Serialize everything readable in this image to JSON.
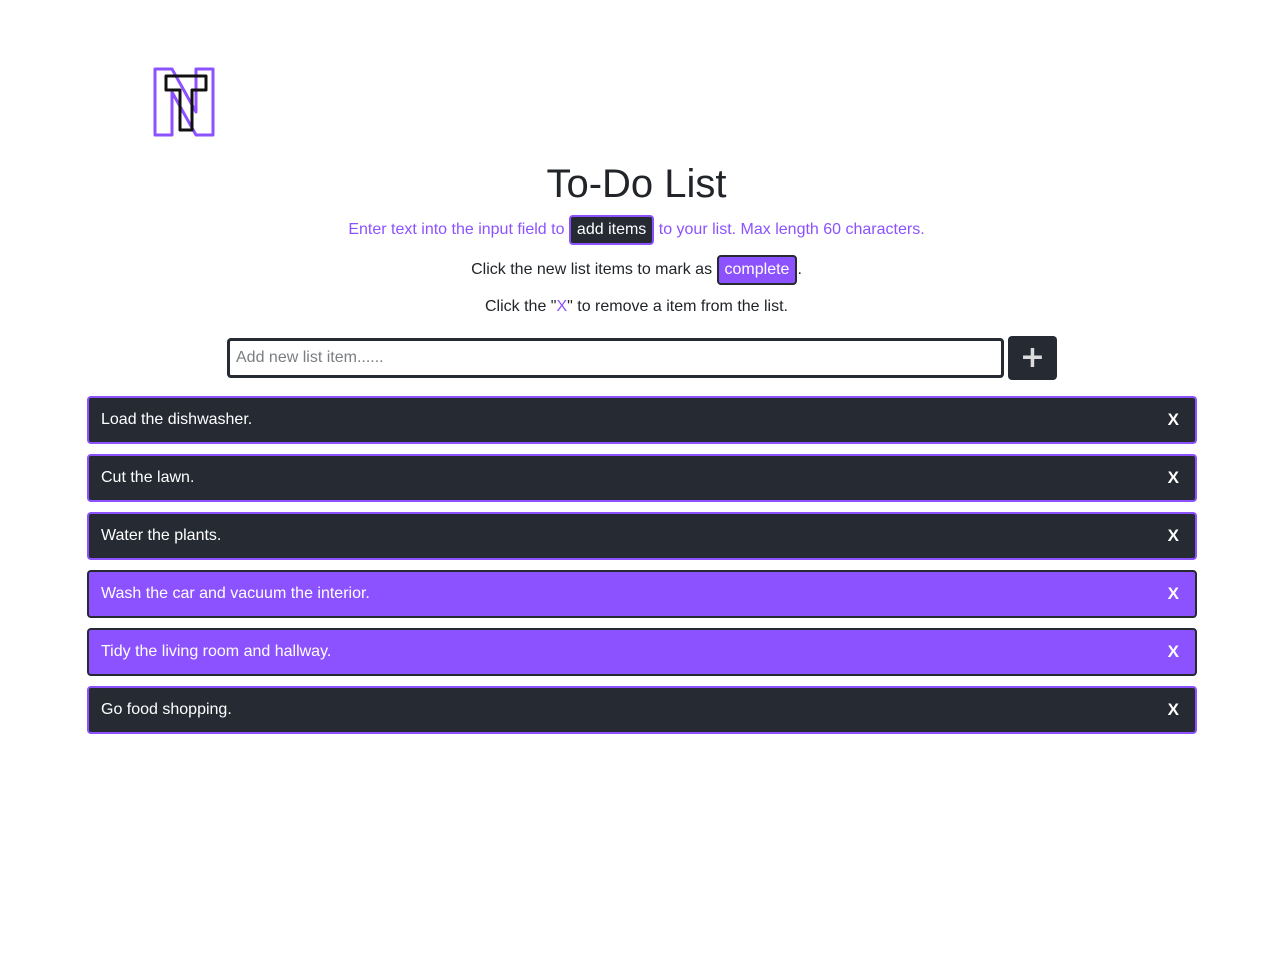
{
  "header": {
    "logo_letters": "TN",
    "title": "To-Do List"
  },
  "instructions": {
    "line1_before": "Enter text into the input field to ",
    "line1_chip": "add items",
    "line1_after": " to your list. Max length 60 characters.",
    "line2_before": "Click the new list items to mark as ",
    "line2_chip": "complete",
    "line2_after": ".",
    "line3_before": "Click the \"",
    "line3_x": "X",
    "line3_after": "\" to remove a item from the list."
  },
  "form": {
    "input_value": "",
    "input_placeholder": "Add new list item......",
    "add_button_label": "+"
  },
  "todos": {
    "remove_label": "X",
    "items": [
      {
        "text": "Load the dishwasher.",
        "completed": false
      },
      {
        "text": "Cut the lawn.",
        "completed": false
      },
      {
        "text": "Water the plants.",
        "completed": false
      },
      {
        "text": "Wash the car and vacuum the interior.",
        "completed": true
      },
      {
        "text": "Tidy the living room and hallway.",
        "completed": true
      },
      {
        "text": "Go food shopping.",
        "completed": false
      }
    ]
  },
  "colors": {
    "accent": "#8c52ff",
    "dark": "#252a33",
    "white": "#ffffff"
  }
}
